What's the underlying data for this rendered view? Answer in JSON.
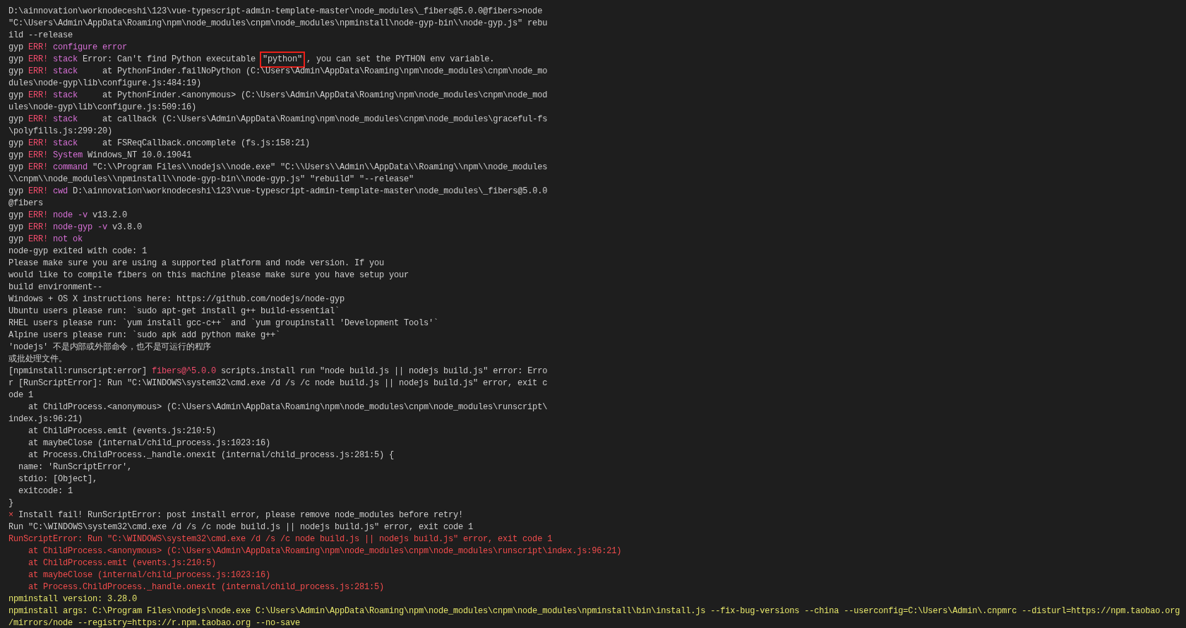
{
  "terminal": {
    "lines": [
      {
        "segments": [
          {
            "kind": "plain",
            "text": "D:\\ainnovation\\worknodeceshi\\123\\vue-typescript-admin-template-master\\node_modules\\_fibers@5.0.0@fibers>node"
          }
        ]
      },
      {
        "segments": [
          {
            "kind": "plain",
            "text": "\"C:\\Users\\Admin\\AppData\\Roaming\\npm\\node_modules\\cnpm\\node_modules\\npminstall\\node-gyp-bin\\\\node-gyp.js\" rebu"
          }
        ]
      },
      {
        "segments": [
          {
            "kind": "plain",
            "text": "ild --release"
          }
        ]
      },
      {
        "segments": [
          {
            "kind": "plain",
            "text": "gyp "
          },
          {
            "kind": "err",
            "text": "ERR! "
          },
          {
            "kind": "label",
            "text": "configure error"
          }
        ]
      },
      {
        "segments": [
          {
            "kind": "plain",
            "text": "gyp "
          },
          {
            "kind": "err",
            "text": "ERR! "
          },
          {
            "kind": "label",
            "text": "stack"
          },
          {
            "kind": "plain",
            "text": " Error: Can't find Python executable "
          },
          {
            "kind": "highlight",
            "text": "\"python\""
          },
          {
            "kind": "plain",
            "text": ", you can set the PYTHON env variable."
          }
        ]
      },
      {
        "segments": [
          {
            "kind": "plain",
            "text": "gyp "
          },
          {
            "kind": "err",
            "text": "ERR! "
          },
          {
            "kind": "label",
            "text": "stack"
          },
          {
            "kind": "plain",
            "text": "     at PythonFinder.failNoPython (C:\\Users\\Admin\\AppData\\Roaming\\npm\\node_modules\\cnpm\\node_mo"
          }
        ]
      },
      {
        "segments": [
          {
            "kind": "plain",
            "text": "dules\\node-gyp\\lib\\configure.js:484:19)"
          }
        ]
      },
      {
        "segments": [
          {
            "kind": "plain",
            "text": "gyp "
          },
          {
            "kind": "err",
            "text": "ERR! "
          },
          {
            "kind": "label",
            "text": "stack"
          },
          {
            "kind": "plain",
            "text": "     at PythonFinder.<anonymous> (C:\\Users\\Admin\\AppData\\Roaming\\npm\\node_modules\\cnpm\\node_mod"
          }
        ]
      },
      {
        "segments": [
          {
            "kind": "plain",
            "text": "ules\\node-gyp\\lib\\configure.js:509:16)"
          }
        ]
      },
      {
        "segments": [
          {
            "kind": "plain",
            "text": "gyp "
          },
          {
            "kind": "err",
            "text": "ERR! "
          },
          {
            "kind": "label",
            "text": "stack"
          },
          {
            "kind": "plain",
            "text": "     at callback (C:\\Users\\Admin\\AppData\\Roaming\\npm\\node_modules\\cnpm\\node_modules\\graceful-fs"
          }
        ]
      },
      {
        "segments": [
          {
            "kind": "plain",
            "text": "\\polyfills.js:299:20)"
          }
        ]
      },
      {
        "segments": [
          {
            "kind": "plain",
            "text": "gyp "
          },
          {
            "kind": "err",
            "text": "ERR! "
          },
          {
            "kind": "label",
            "text": "stack"
          },
          {
            "kind": "plain",
            "text": "     at FSReqCallback.oncomplete (fs.js:158:21)"
          }
        ]
      },
      {
        "segments": [
          {
            "kind": "plain",
            "text": "gyp "
          },
          {
            "kind": "err",
            "text": "ERR! "
          },
          {
            "kind": "label",
            "text": "System"
          },
          {
            "kind": "plain",
            "text": " Windows_NT 10.0.19041"
          }
        ]
      },
      {
        "segments": [
          {
            "kind": "plain",
            "text": "gyp "
          },
          {
            "kind": "err",
            "text": "ERR! "
          },
          {
            "kind": "label",
            "text": "command"
          },
          {
            "kind": "plain",
            "text": " \"C:\\\\Program Files\\\\nodejs\\\\node.exe\" \"C:\\\\Users\\\\Admin\\\\AppData\\\\Roaming\\\\npm\\\\node_modules"
          }
        ]
      },
      {
        "segments": [
          {
            "kind": "plain",
            "text": "\\\\cnpm\\\\node_modules\\\\npminstall\\\\node-gyp-bin\\\\node-gyp.js\" \"rebuild\" \"--release\""
          }
        ]
      },
      {
        "segments": [
          {
            "kind": "plain",
            "text": "gyp "
          },
          {
            "kind": "err",
            "text": "ERR! "
          },
          {
            "kind": "label",
            "text": "cwd"
          },
          {
            "kind": "plain",
            "text": " D:\\ainnovation\\worknodeceshi\\123\\vue-typescript-admin-template-master\\node_modules\\_fibers@5.0.0"
          }
        ]
      },
      {
        "segments": [
          {
            "kind": "plain",
            "text": "@fibers"
          }
        ]
      },
      {
        "segments": [
          {
            "kind": "plain",
            "text": "gyp "
          },
          {
            "kind": "err",
            "text": "ERR! "
          },
          {
            "kind": "label",
            "text": "node -v"
          },
          {
            "kind": "plain",
            "text": " v13.2.0"
          }
        ]
      },
      {
        "segments": [
          {
            "kind": "plain",
            "text": "gyp "
          },
          {
            "kind": "err",
            "text": "ERR! "
          },
          {
            "kind": "label",
            "text": "node-gyp -v"
          },
          {
            "kind": "plain",
            "text": " v3.8.0"
          }
        ]
      },
      {
        "segments": [
          {
            "kind": "plain",
            "text": "gyp "
          },
          {
            "kind": "err",
            "text": "ERR! "
          },
          {
            "kind": "label",
            "text": "not ok"
          }
        ]
      },
      {
        "segments": [
          {
            "kind": "plain",
            "text": "node-gyp exited with code: 1"
          }
        ]
      },
      {
        "segments": [
          {
            "kind": "plain",
            "text": "Please make sure you are using a supported platform and node version. If you"
          }
        ]
      },
      {
        "segments": [
          {
            "kind": "plain",
            "text": "would like to compile fibers on this machine please make sure you have setup your"
          }
        ]
      },
      {
        "segments": [
          {
            "kind": "plain",
            "text": "build environment--"
          }
        ]
      },
      {
        "segments": [
          {
            "kind": "plain",
            "text": "Windows + OS X instructions here: https://github.com/nodejs/node-gyp"
          }
        ]
      },
      {
        "segments": [
          {
            "kind": "plain",
            "text": "Ubuntu users please run: `sudo apt-get install g++ build-essential`"
          }
        ]
      },
      {
        "segments": [
          {
            "kind": "plain",
            "text": "RHEL users please run: `yum install gcc-c++` and `yum groupinstall 'Development Tools'`"
          }
        ]
      },
      {
        "segments": [
          {
            "kind": "plain",
            "text": "Alpine users please run: `sudo apk add python make g++`"
          }
        ]
      },
      {
        "segments": [
          {
            "kind": "plain",
            "text": "'nodejs' 不是内部或外部命令，也不是可运行的程序"
          }
        ]
      },
      {
        "segments": [
          {
            "kind": "plain",
            "text": "或批处理文件。"
          }
        ]
      },
      {
        "segments": [
          {
            "kind": "plain",
            "text": "[npminstall:runscript:error] "
          },
          {
            "kind": "err",
            "text": "fibers@^5.0.0"
          },
          {
            "kind": "plain",
            "text": " scripts.install run \"node build.js || nodejs build.js\" error: Erro"
          }
        ]
      },
      {
        "segments": [
          {
            "kind": "plain",
            "text": "r [RunScriptError]: Run \"C:\\WINDOWS\\system32\\cmd.exe /d /s /c node build.js || nodejs build.js\" error, exit c"
          }
        ]
      },
      {
        "segments": [
          {
            "kind": "plain",
            "text": "ode 1"
          }
        ]
      },
      {
        "segments": [
          {
            "kind": "plain",
            "text": "    at ChildProcess.<anonymous> (C:\\Users\\Admin\\AppData\\Roaming\\npm\\node_modules\\cnpm\\node_modules\\runscript\\"
          }
        ]
      },
      {
        "segments": [
          {
            "kind": "plain",
            "text": "index.js:96:21)"
          }
        ]
      },
      {
        "segments": [
          {
            "kind": "plain",
            "text": "    at ChildProcess.emit (events.js:210:5)"
          }
        ]
      },
      {
        "segments": [
          {
            "kind": "plain",
            "text": "    at maybeClose (internal/child_process.js:1023:16)"
          }
        ]
      },
      {
        "segments": [
          {
            "kind": "plain",
            "text": "    at Process.ChildProcess._handle.onexit (internal/child_process.js:281:5) {"
          }
        ]
      },
      {
        "segments": [
          {
            "kind": "plain",
            "text": "  name: 'RunScriptError',"
          }
        ]
      },
      {
        "segments": [
          {
            "kind": "plain",
            "text": "  stdio: [Object],"
          }
        ]
      },
      {
        "segments": [
          {
            "kind": "plain",
            "text": "  exitcode: 1"
          }
        ]
      },
      {
        "segments": [
          {
            "kind": "plain",
            "text": "}"
          }
        ]
      },
      {
        "segments": [
          {
            "kind": "error",
            "text": "×"
          },
          {
            "kind": "plain",
            "text": " Install fail! RunScriptError: post install error, please remove node_modules before retry!"
          }
        ]
      },
      {
        "segments": [
          {
            "kind": "plain",
            "text": "Run \"C:\\WINDOWS\\system32\\cmd.exe /d /s /c node build.js || nodejs build.js\" error, exit code 1"
          }
        ]
      },
      {
        "segments": [
          {
            "kind": "error",
            "text": "RunScriptError: Run \"C:\\WINDOWS\\system32\\cmd.exe /d /s /c node build.js || nodejs build.js\" error, exit code 1"
          }
        ]
      },
      {
        "segments": [
          {
            "kind": "error",
            "text": "    at ChildProcess.<anonymous> (C:\\Users\\Admin\\AppData\\Roaming\\npm\\node_modules\\cnpm\\node_modules\\runscript\\index.js:96:21)"
          }
        ]
      },
      {
        "segments": [
          {
            "kind": "error",
            "text": "    at ChildProcess.emit (events.js:210:5)"
          }
        ]
      },
      {
        "segments": [
          {
            "kind": "error",
            "text": "    at maybeClose (internal/child_process.js:1023:16)"
          }
        ]
      },
      {
        "segments": [
          {
            "kind": "error",
            "text": "    at Process.ChildProcess._handle.onexit (internal/child_process.js:281:5)"
          }
        ]
      },
      {
        "segments": [
          {
            "kind": "info",
            "text": "npminstall version: 3.28.0"
          }
        ]
      },
      {
        "segments": [
          {
            "kind": "info",
            "text": "npminstall args: C:\\Program Files\\nodejs\\node.exe C:\\Users\\Admin\\AppData\\Roaming\\npm\\node_modules\\cnpm\\node_modules\\npminstall\\bin\\install.js --fix-bug-versions --china --userconfig=C:\\Users\\Admin\\.cnpmrc --disturl=https://npm.taobao.org"
          }
        ]
      },
      {
        "segments": [
          {
            "kind": "info",
            "text": "/mirrors/node --registry=https://r.npm.taobao.org --no-save"
          }
        ]
      }
    ]
  }
}
